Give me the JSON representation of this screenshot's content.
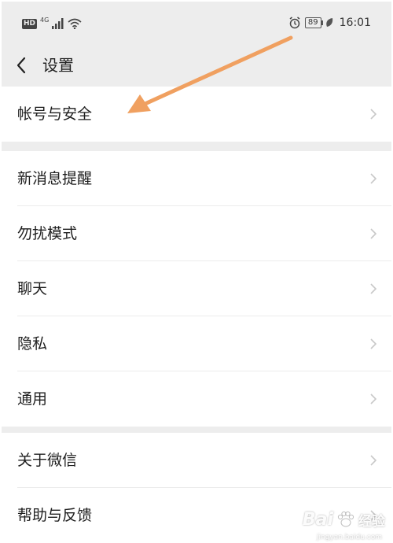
{
  "status_bar": {
    "hd_badge": "HD",
    "network": "4G",
    "battery": "89",
    "time": "16:01"
  },
  "header": {
    "title": "设置"
  },
  "settings": {
    "groups": [
      {
        "items": [
          {
            "label": "帐号与安全"
          }
        ]
      },
      {
        "items": [
          {
            "label": "新消息提醒"
          },
          {
            "label": "勿扰模式"
          },
          {
            "label": "聊天"
          },
          {
            "label": "隐私"
          },
          {
            "label": "通用"
          }
        ]
      },
      {
        "items": [
          {
            "label": "关于微信"
          },
          {
            "label": "帮助与反馈"
          }
        ]
      }
    ]
  },
  "annotation": {
    "color": "#f0a060"
  },
  "watermark": {
    "brand": "Bai",
    "sub": "经验",
    "url": "jingyan.baidu.com"
  }
}
